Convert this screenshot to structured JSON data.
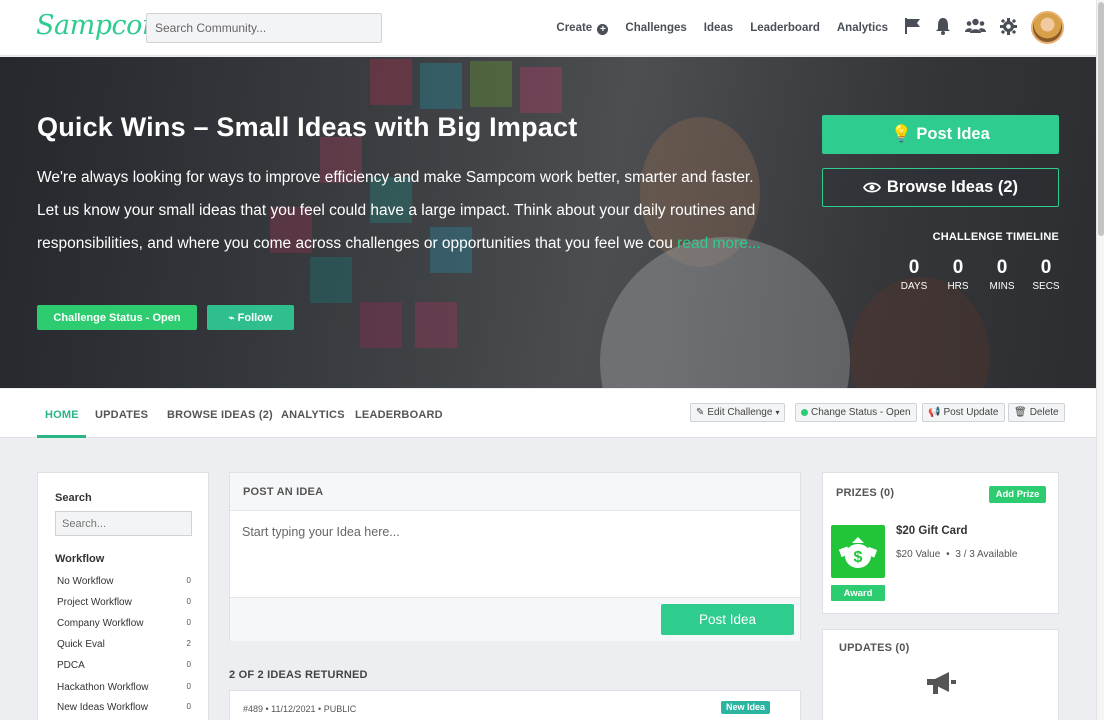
{
  "brand": {
    "logo": "Sampcom",
    "accent": "#2ecc8e"
  },
  "topnav": {
    "search_placeholder": "Search Community...",
    "links": {
      "create": "Create",
      "challenges": "Challenges",
      "ideas": "Ideas",
      "leaderboard": "Leaderboard",
      "analytics": "Analytics"
    },
    "icons": [
      "flag-icon",
      "bell-icon",
      "users-icon",
      "gear-icon"
    ]
  },
  "hero": {
    "title": "Quick Wins – Small Ideas with Big Impact",
    "description": "We're always looking for ways to improve efficiency and make Sampcom work better, smarter and faster. Let us know your small ideas that you feel could have a large impact. Think about your daily routines and responsibilities, and where you come across challenges or opportunities that you feel we cou",
    "read_more": "read more...",
    "status_button": "Challenge Status - Open",
    "follow_button": "Follow",
    "post_idea_button": "Post Idea",
    "browse_ideas_button": "Browse Ideas (2)",
    "timeline_label": "CHALLENGE TIMELINE",
    "countdown": {
      "days": "0",
      "days_label": "DAYS",
      "hrs": "0",
      "hrs_label": "HRS",
      "mins": "0",
      "mins_label": "MINS",
      "secs": "0",
      "secs_label": "SECS"
    }
  },
  "tabs": {
    "home": "HOME",
    "updates": "UPDATES",
    "browse": "BROWSE IDEAS (2)",
    "analytics": "ANALYTICS",
    "leaderboard": "LEADERBOARD",
    "active": "HOME"
  },
  "actions": {
    "edit": "Edit Challenge",
    "change_status": "Change Status - Open",
    "post_update": "Post Update",
    "delete": "Delete"
  },
  "sidebar": {
    "search_label": "Search",
    "search_placeholder": "Search...",
    "workflow_label": "Workflow",
    "workflows": [
      {
        "name": "No Workflow",
        "count": "0"
      },
      {
        "name": "Project Workflow",
        "count": "0"
      },
      {
        "name": "Company Workflow",
        "count": "0"
      },
      {
        "name": "Quick Eval",
        "count": "2"
      },
      {
        "name": "PDCA",
        "count": "0"
      },
      {
        "name": "Hackathon Workflow",
        "count": "0"
      },
      {
        "name": "New Ideas Workflow",
        "count": "0"
      }
    ]
  },
  "post_box": {
    "heading": "POST AN IDEA",
    "placeholder": "Start typing your Idea here...",
    "button": "Post Idea"
  },
  "ideas": {
    "returned": "2 OF 2 IDEAS RETURNED",
    "items": [
      {
        "meta": "#489 • 11/12/2021 • PUBLIC",
        "badge": "New Idea"
      }
    ]
  },
  "prizes": {
    "title": "PRIZES (0)",
    "add_button": "Add Prize",
    "items": [
      {
        "name": "$20 Gift Card",
        "value": "$20 Value",
        "availability": "3 / 3 Available",
        "award_button": "Award"
      }
    ]
  },
  "updates": {
    "title": "UPDATES (0)"
  }
}
